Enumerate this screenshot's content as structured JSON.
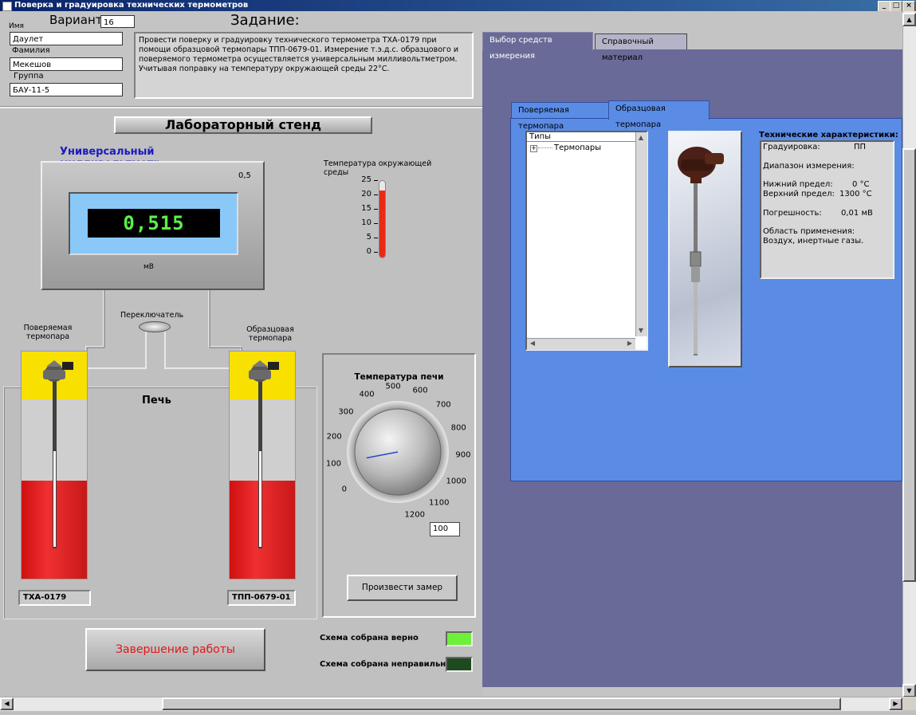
{
  "window": {
    "title": "Поверка и градуировка технических термометров",
    "controls": [
      "_",
      "□",
      "×"
    ]
  },
  "form": {
    "variant_label": "Вариант",
    "variant_value": "16",
    "name_label": "Имя",
    "name_value": "Даулет",
    "surname_label": "Фамилия",
    "surname_value": "Мекешов",
    "group_label": "Группа",
    "group_value": "БАУ-11-5"
  },
  "task": {
    "title": "Задание:",
    "text": "Провести поверку и градуировку технического термометра ТХА-0179 при помощи образцовой термопары ТПП-0679-01. Измерение т.э.д.с. образцового и поверяемого термометра осуществляется универсальным милливольтметром. Учитывая поправку на температуру окружающей среды 22°С."
  },
  "stand": {
    "title": "Лабораторный стенд",
    "mv_title": "Универсальный милливольтметр",
    "mv_range": "0,5",
    "mv_display": "0,515",
    "mv_unit": "мВ",
    "ambient_label": "Температура окружающей среды",
    "ambient_ticks": [
      "25",
      "20",
      "15",
      "10",
      "5",
      "0"
    ],
    "ambient_level": 0.88,
    "switch_label": "Переключатель",
    "left_tc_label": "Поверяемая термопара",
    "right_tc_label": "Образцовая термопара",
    "furnace_label": "Печь",
    "left_tc_name": "ТХА-0179",
    "right_tc_name": "ТПП-0679-01",
    "furnace_temp_title": "Температура печи",
    "dial_labels": [
      "0",
      "100",
      "200",
      "300",
      "400",
      "500",
      "600",
      "700",
      "800",
      "900",
      "1000",
      "1100",
      "1200"
    ],
    "furnace_temp_value": "100",
    "measure_button": "Произвести замер",
    "finish_button": "Завершение работы",
    "ok_label": "Схема собрана верно",
    "err_label": "Схема собрана неправильно",
    "ok_color": "#6ef03a",
    "err_color": "#1f4a1f"
  },
  "right": {
    "tabs": [
      "Выбор средств измерения",
      "Справочный материал"
    ],
    "subtabs": [
      "Поверяемая термопара",
      "Образцовая термопара"
    ],
    "tree_header": "Типы",
    "tree_item": "Термопары",
    "specs_title": "Технические характеристики:",
    "grad_label": "Градуировка:",
    "grad_value": "ПП",
    "range_label": "Диапазон измерения:",
    "lower_label": "Нижний предел:",
    "lower_value": "0 °С",
    "upper_label": "Верхний предел:",
    "upper_value": "1300 °С",
    "error_label": "Погрешность:",
    "error_value": "0,01 мВ",
    "area_label": "Область применения:",
    "area_value": "Воздух, инертные газы."
  }
}
